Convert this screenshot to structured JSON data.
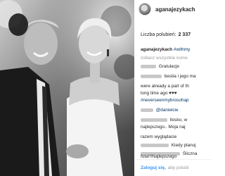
{
  "header": {
    "username": "aganajezykach",
    "avatar_icon": "profile-avatar"
  },
  "likes": {
    "label": "Liczba polubień:",
    "count": "2 337"
  },
  "comments": [
    {
      "user": "aganajezykach",
      "text": "#withmy"
    },
    {
      "user": "",
      "text": "zobacz wszystkie kome"
    },
    {
      "user": "",
      "text": "Gratulacje"
    },
    {
      "user": "",
      "text": "bestia i jego ma"
    },
    {
      "user": "",
      "text": "were already a part of th"
    },
    {
      "user": "",
      "text": "long time ago ♥♥♥"
    },
    {
      "user": "",
      "text": "#neverseenmybrosohap"
    },
    {
      "user": "",
      "text": "@danielcie"
    },
    {
      "user": "",
      "text": "llosko, w"
    },
    {
      "user": "",
      "text": "najlepszego.. Moja naj"
    },
    {
      "user": "",
      "text": "razem wyglądacie"
    },
    {
      "user": "",
      "text": "Kiedy planuj"
    },
    {
      "user": "",
      "text": "Śliczna"
    },
    {
      "user": "",
      "text": "fota!!!Najlepszego"
    }
  ],
  "footer": {
    "login_label": "Zaloguj się,",
    "rest": "aby polubi"
  }
}
